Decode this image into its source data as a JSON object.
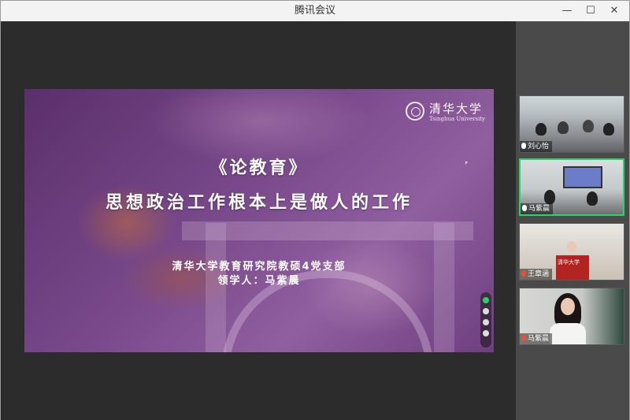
{
  "window": {
    "title": "腾讯会议"
  },
  "titlebar_controls": {
    "minimize": "—",
    "maximize": "☐",
    "close": "✕"
  },
  "slide": {
    "logo_cn": "清华大学",
    "logo_en": "Tsinghua University",
    "title_line1": "《论教育》",
    "title_line2": "思想政治工作根本上是做人的工作",
    "subtitle_line1": "清华大学教育研究院教硕4党支部",
    "subtitle_line2": "领学人：马紫晨"
  },
  "participants": [
    {
      "name": "刘心怡",
      "mic": "on",
      "active": false
    },
    {
      "name": "马紫晨",
      "mic": "on",
      "active": true
    },
    {
      "name": "王章涵",
      "mic": "muted",
      "active": false
    },
    {
      "name": "马紫晨",
      "mic": "muted",
      "active": false
    }
  ],
  "podium_text": "清华大学",
  "colors": {
    "active_border": "#2bd266",
    "muted_mic": "#e6503c"
  }
}
